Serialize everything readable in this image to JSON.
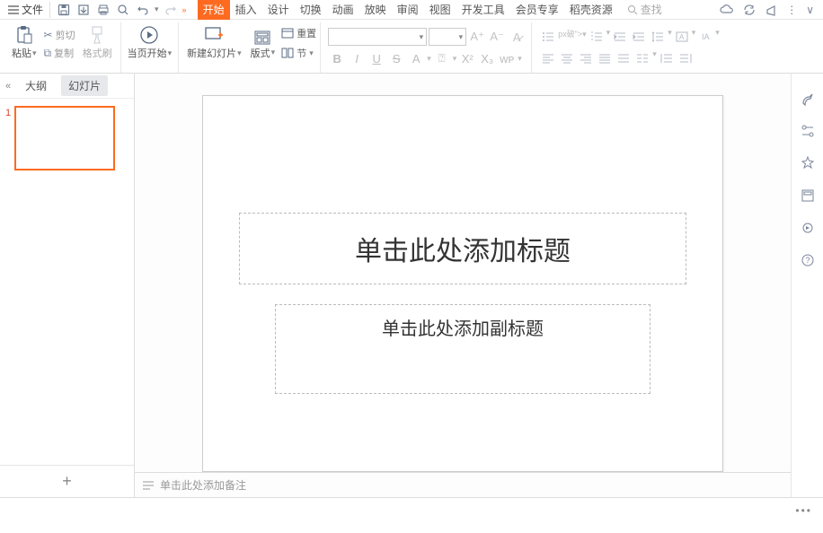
{
  "menubar": {
    "file": "文件",
    "tabs": [
      "开始",
      "插入",
      "设计",
      "切换",
      "动画",
      "放映",
      "审阅",
      "视图",
      "开发工具",
      "会员专享",
      "稻壳资源"
    ],
    "active_tab_index": 0,
    "search_placeholder": "查找"
  },
  "ribbon": {
    "paste": "粘贴",
    "cut": "剪切",
    "copy": "复制",
    "format_painter": "格式刷",
    "from_current": "当页开始",
    "new_slide": "新建幻灯片",
    "layout": "版式",
    "section": "节",
    "reset": "重置"
  },
  "left_panel": {
    "outline_tab": "大纲",
    "slides_tab": "幻灯片",
    "slide_number": "1"
  },
  "slide": {
    "title_placeholder": "单击此处添加标题",
    "subtitle_placeholder": "单击此处添加副标题"
  },
  "notes": {
    "placeholder": "单击此处添加备注"
  }
}
